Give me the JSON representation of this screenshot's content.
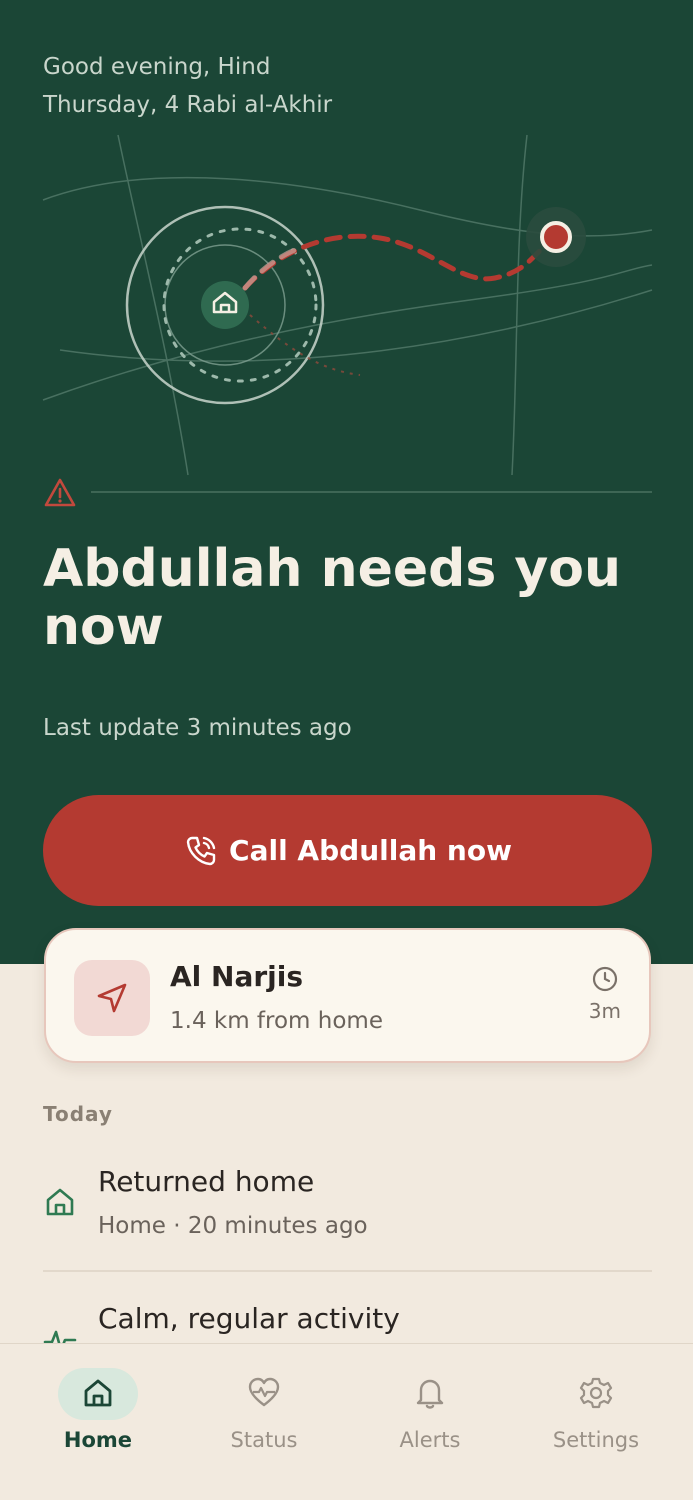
{
  "header": {
    "greeting": "Good evening, Hind",
    "date": "Thursday, 4 Rabi al-Akhir"
  },
  "alert": {
    "icon": "warning-triangle-icon",
    "headline": "Abdullah needs you now",
    "last_update": "Last update 3 minutes ago"
  },
  "call_button": {
    "icon": "phone-icon",
    "label": "Call Abdullah now"
  },
  "location_card": {
    "icon": "navigation-arrow-icon",
    "place": "Al Narjis",
    "distance": "1.4 km from home",
    "time_icon": "clock-icon",
    "time_ago": "3m"
  },
  "activity": {
    "section_label": "Today",
    "items": [
      {
        "icon": "home-icon",
        "title": "Returned home",
        "subtitle": "Home · 20 minutes ago"
      },
      {
        "icon": "heartbeat-icon",
        "title": "Calm, regular activity",
        "subtitle": ""
      }
    ]
  },
  "nav": {
    "items": [
      {
        "icon": "home-icon",
        "label": "Home",
        "active": true
      },
      {
        "icon": "heart-pulse-icon",
        "label": "Status",
        "active": false
      },
      {
        "icon": "bell-icon",
        "label": "Alerts",
        "active": false
      },
      {
        "icon": "gear-icon",
        "label": "Settings",
        "active": false
      }
    ]
  },
  "colors": {
    "hero_background": "#1B4636",
    "accent_red": "#B43A31",
    "page_background": "#F2EADF",
    "active_green": "#1B4636"
  }
}
